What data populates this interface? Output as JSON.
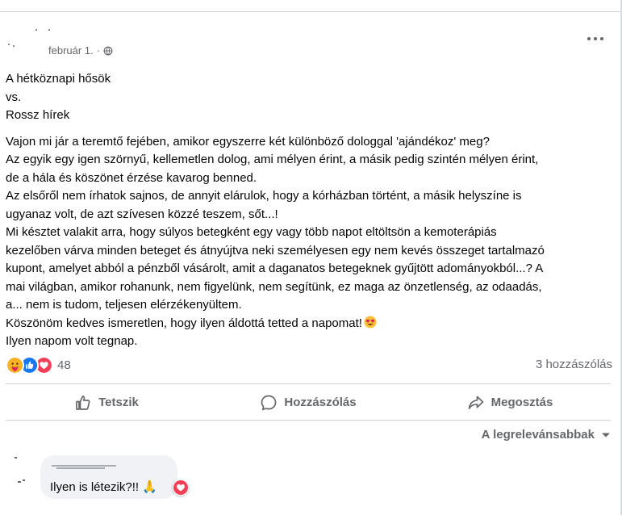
{
  "post": {
    "date": "február 1.",
    "separator": "·",
    "title_lines": "A hétköznapi hősök\nvs.\nRossz hírek",
    "body": "Vajon mi jár a teremtő fejében, amikor egyszerre két különböző dologgal 'ajándékoz' meg?\nAz egyik egy igen szörnyű, kellemetlen dolog, ami mélyen érint, a másik pedig szintén mélyen érint,\nde a hála és köszönet érzése kavarog benned.\nAz elsőről nem írhatok sajnos, de annyit elárulok, hogy a kórházban történt, a másik helyszíne is\nugyanaz volt, de azt szívesen közzé teszem, sőt...!\nMi késztet valakit arra, hogy súlyos betegként egy vagy több napot eltöltsön a kemoterápiás\nkezelőben várva minden beteget és átnyújtva neki személyesen egy nem kevés összeget tartalmazó\nkupont, amelyet abból a pénzből vásárolt, amit a daganatos betegeknek gyűjtött adományokból...? A\nmai világban, amikor rohanunk, nem figyelünk, nem segítünk, ez maga az önzetlenség, az odaadás,\na... nem is tudom, teljesen elérzékenyültem.\nKöszönöm kedves ismeretlen, hogy ilyen áldottá tetted a napomat!",
    "body_end_emoji": "heart-eyes-emoji",
    "last_line": "Ilyen napom volt tegnap."
  },
  "stats": {
    "reaction_icons": [
      "care-emoji",
      "like-icon",
      "love-icon"
    ],
    "reaction_count": "48",
    "comments": "3 hozzászólás"
  },
  "actions": {
    "like": "Tetszik",
    "comment": "Hozzászólás",
    "share": "Megosztás"
  },
  "sort": {
    "label": "A legrelevánsabbak"
  },
  "comment": {
    "text": "Ilyen is létezik?!! 🙏",
    "reaction_icon": "love-icon"
  },
  "colors": {
    "like_blue": "#1877f2",
    "love_red": "#f33e58",
    "care_yellow": "#f7b125",
    "secondary_text": "#65676b",
    "bubble_bg": "#f0f2f5",
    "divider": "#ced0d4"
  }
}
